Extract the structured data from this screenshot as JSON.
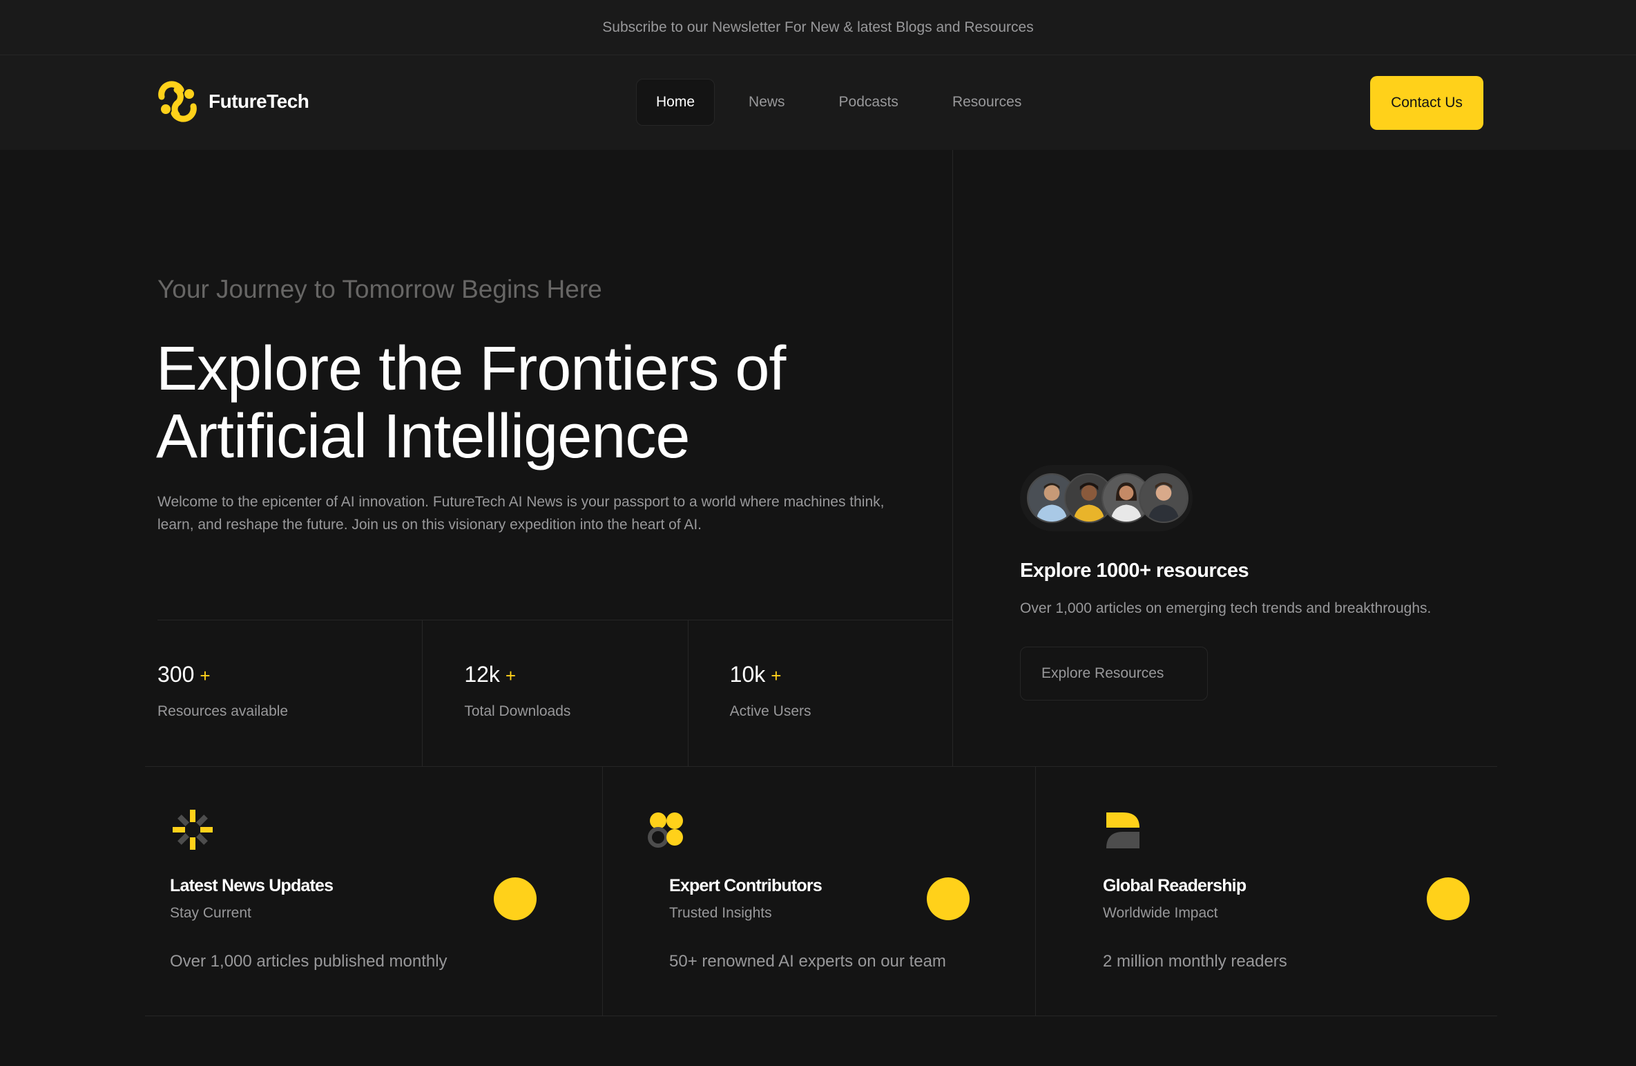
{
  "topbar": {
    "text": "Subscribe to our Newsletter For New & latest Blogs and Resources"
  },
  "header": {
    "logo_text": "FutureTech",
    "nav": [
      {
        "label": "Home",
        "active": true
      },
      {
        "label": "News",
        "active": false
      },
      {
        "label": "Podcasts",
        "active": false
      },
      {
        "label": "Resources",
        "active": false
      }
    ],
    "contact_label": "Contact Us"
  },
  "hero": {
    "subtitle": "Your Journey to Tomorrow Begins Here",
    "title_line1": "Explore the Frontiers of",
    "title_line2": "Artificial Intelligence",
    "description": "Welcome to the epicenter of AI innovation. FutureTech AI News is your passport to a world where machines think, learn, and reshape the future. Join us on this visionary expedition into the heart of AI.",
    "stats": [
      {
        "value": "300",
        "plus": "+",
        "label": "Resources available"
      },
      {
        "value": "12k",
        "plus": "+",
        "label": "Total Downloads"
      },
      {
        "value": "10k",
        "plus": "+",
        "label": "Active Users"
      }
    ]
  },
  "resources_card": {
    "title": "Explore 1000+ resources",
    "description": "Over 1,000 articles on emerging tech trends and breakthroughs.",
    "button_label": "Explore Resources"
  },
  "features": [
    {
      "icon": "asterisk-burst-icon",
      "title": "Latest News Updates",
      "subtitle": "Stay Current",
      "description": "Over 1,000 articles published monthly"
    },
    {
      "icon": "four-circles-icon",
      "title": "Expert Contributors",
      "subtitle": "Trusted Insights",
      "description": "50+ renowned AI experts on our team"
    },
    {
      "icon": "half-leaf-icon",
      "title": "Global Readership",
      "subtitle": "Worldwide Impact",
      "description": "2 million monthly readers"
    }
  ],
  "colors": {
    "accent": "#ffd11a",
    "background": "#141414",
    "surface": "#1a1a1a",
    "border": "#262626",
    "muted": "#98989a"
  }
}
